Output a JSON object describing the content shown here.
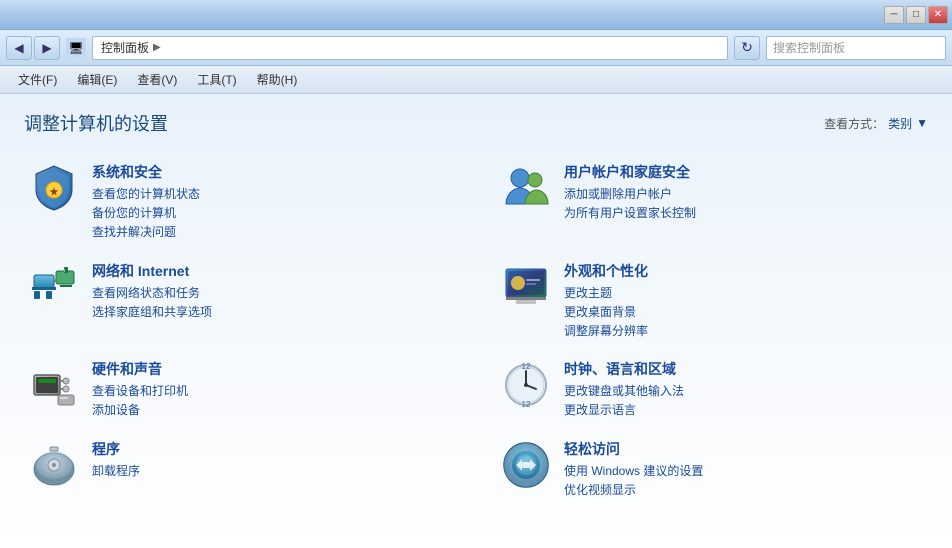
{
  "titlebar": {
    "minimize_label": "─",
    "restore_label": "□",
    "close_label": "✕"
  },
  "addressbar": {
    "back_label": "◀",
    "forward_label": "▶",
    "path_root": "控制面板",
    "path_separator": "▶",
    "refresh_label": "↻",
    "search_placeholder": "搜索控制面板"
  },
  "menubar": {
    "items": [
      {
        "label": "文件(F)"
      },
      {
        "label": "编辑(E)"
      },
      {
        "label": "查看(V)"
      },
      {
        "label": "工具(T)"
      },
      {
        "label": "帮助(H)"
      }
    ]
  },
  "page": {
    "title": "调整计算机的设置",
    "view_mode_prefix": "查看方式：",
    "view_mode_value": "类别",
    "view_mode_arrow": "▼"
  },
  "categories": [
    {
      "id": "security",
      "title": "系统和安全",
      "links": [
        "查看您的计算机状态",
        "备份您的计算机",
        "查找并解决问题"
      ]
    },
    {
      "id": "users",
      "title": "用户帐户和家庭安全",
      "links": [
        "添加或删除用户帐户",
        "为所有用户设置家长控制"
      ]
    },
    {
      "id": "network",
      "title": "网络和 Internet",
      "links": [
        "查看网络状态和任务",
        "选择家庭组和共享选项"
      ]
    },
    {
      "id": "appearance",
      "title": "外观和个性化",
      "links": [
        "更改主题",
        "更改桌面背景",
        "调整屏幕分辨率"
      ]
    },
    {
      "id": "hardware",
      "title": "硬件和声音",
      "links": [
        "查看设备和打印机",
        "添加设备"
      ]
    },
    {
      "id": "clock",
      "title": "时钟、语言和区域",
      "links": [
        "更改键盘或其他输入法",
        "更改显示语言"
      ]
    },
    {
      "id": "programs",
      "title": "程序",
      "links": [
        "卸载程序"
      ]
    },
    {
      "id": "access",
      "title": "轻松访问",
      "links": [
        "使用 Windows 建议的设置",
        "优化视频显示"
      ]
    }
  ]
}
